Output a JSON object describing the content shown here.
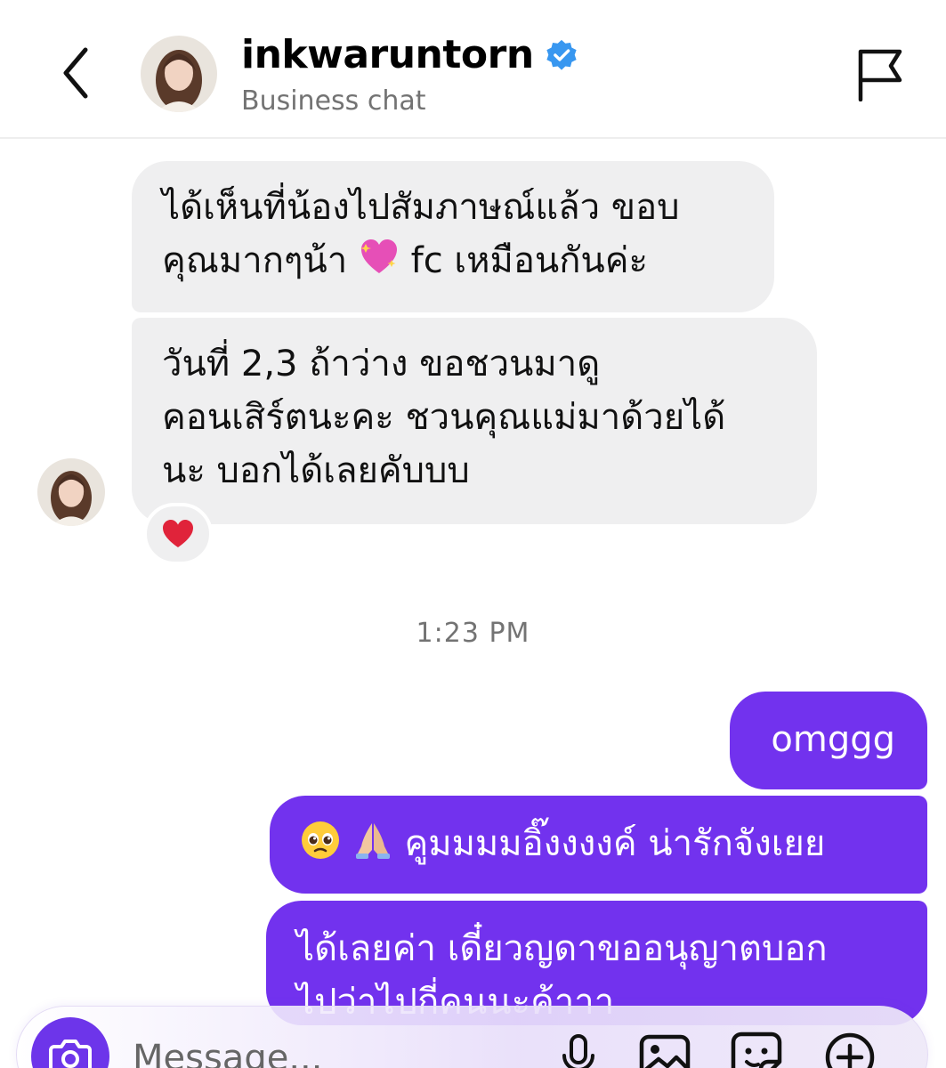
{
  "header": {
    "username": "inkwaruntorn",
    "subtitle": "Business chat",
    "verified_icon": "verified-badge-icon",
    "verified_color": "#3897f0"
  },
  "messages": {
    "m1": "ได้เห็นที่น้องไปสัมภาษณ์แล้ว ขอบ\nคุณมากๆน้า 💖 fc เหมือนกันค่ะ",
    "m1_a": "ได้เห็นที่น้องไปสัมภาษณ์แล้ว ขอบ",
    "m1_b": "คุณมากๆน้า",
    "m1_c": "fc เหมือนกันค่ะ",
    "m2": "วันที่ 2,3 ถ้าว่าง ขอชวนมาดู\nคอนเสิร์ตนะคะ ชวนคุณแม่มาด้วยได้\nนะ บอกได้เลยคับบบ",
    "m2_reaction": "❤",
    "timestamp": "1:23 PM",
    "m3": "omggg",
    "m4_text": "คูมมมมอิ๊งงงงค์ น่ารักจังเยย",
    "m5": "ได้เลยค่า เดี๋ยวญดาขออนุญาตบอก\nไปว่าไปกี่คนนะค้าาา"
  },
  "composer": {
    "placeholder": "Message..."
  },
  "colors": {
    "outgoing_bubble": "#7232ee",
    "incoming_bubble": "#efeff0",
    "accent": "#6d35ea"
  }
}
